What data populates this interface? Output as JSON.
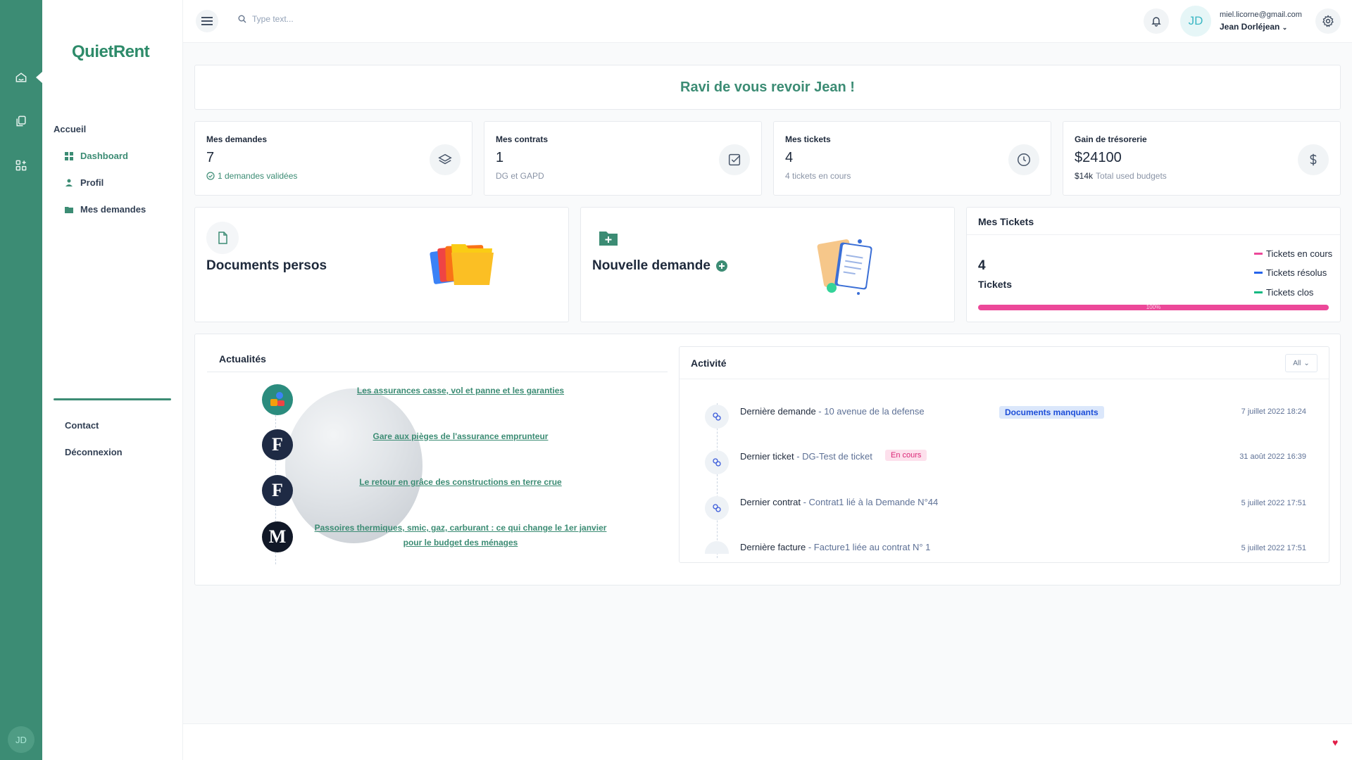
{
  "brand": {
    "logo_text": "QuietRent",
    "accent": "#3c8c74"
  },
  "rail": {
    "avatar_initials": "JD",
    "icons": [
      "home-icon",
      "copy-icon",
      "apps-icon"
    ]
  },
  "sidebar": {
    "section": "Accueil",
    "items": [
      {
        "label": "Dashboard",
        "icon": "dashboard-icon",
        "active": true
      },
      {
        "label": "Profil",
        "icon": "profile-icon"
      },
      {
        "label": "Mes demandes",
        "icon": "folder-icon"
      }
    ],
    "footer": [
      {
        "label": "Contact"
      },
      {
        "label": "Déconnexion"
      }
    ]
  },
  "topbar": {
    "search_placeholder": "Type text...",
    "avatar_initials": "JD",
    "email": "miel.licorne@gmail.com",
    "name": "Jean Dorléjean"
  },
  "welcome": "Ravi de vous revoir Jean !",
  "stats": [
    {
      "title": "Mes demandes",
      "value": "7",
      "sub": "1 demandes validées",
      "icon": "layers-icon"
    },
    {
      "title": "Mes contrats",
      "value": "1",
      "sub": "DG et GAPD",
      "icon": "checkbox-icon"
    },
    {
      "title": "Mes tickets",
      "value": "4",
      "sub": "4 tickets en cours",
      "icon": "clock-icon"
    },
    {
      "title": "Gain de trésorerie",
      "value": "$24100",
      "sub_strong": "$14k",
      "sub": "Total used budgets",
      "icon": "dollar-icon"
    }
  ],
  "cards": {
    "documents": {
      "title": "Documents persos"
    },
    "nouvelle": {
      "title": "Nouvelle demande"
    }
  },
  "tickets_panel": {
    "title": "Mes Tickets",
    "count": "4",
    "label": "Tickets",
    "legend": [
      {
        "label": "Tickets en cours",
        "color": "#ec4899"
      },
      {
        "label": "Tickets résolus",
        "color": "#2563eb"
      },
      {
        "label": "Tickets clos",
        "color": "#10b981"
      }
    ],
    "progress_label": "100%",
    "progress_fraction": 1.0
  },
  "news": {
    "title": "Actualités",
    "items": [
      {
        "text": "Les assurances casse, vol et panne et les garanties",
        "icon": "insurance-icon"
      },
      {
        "text": "Gare aux pièges de l'assurance emprunteur",
        "icon": "figaro-icon",
        "letter": "F"
      },
      {
        "text": "Le retour en grâce des constructions en terre crue",
        "icon": "figaro-icon",
        "letter": "F"
      },
      {
        "text": "Passoires thermiques, smic, gaz, carburant : ce qui change le 1er janvier pour le budget des ménages",
        "icon": "lemonde-icon",
        "letter": "M"
      }
    ]
  },
  "activity": {
    "title": "Activité",
    "filter": "All",
    "items": [
      {
        "label": "Dernière demande",
        "detail": " - 10 avenue de la defense",
        "badge": "Documents manquants",
        "date": "7 juillet 2022 18:24"
      },
      {
        "label": "Dernier ticket",
        "detail": " - DG-Test de ticket",
        "badge": "En cours",
        "date": "31 août 2022 16:39"
      },
      {
        "label": "Dernier contrat",
        "detail": " - Contrat1 lié à la Demande N°44",
        "date": "5 juillet 2022 17:51"
      },
      {
        "label": "Dernière facture",
        "detail": " - Facture1 liée au contrat N° 1",
        "date": "5 juillet 2022 17:51"
      }
    ]
  }
}
